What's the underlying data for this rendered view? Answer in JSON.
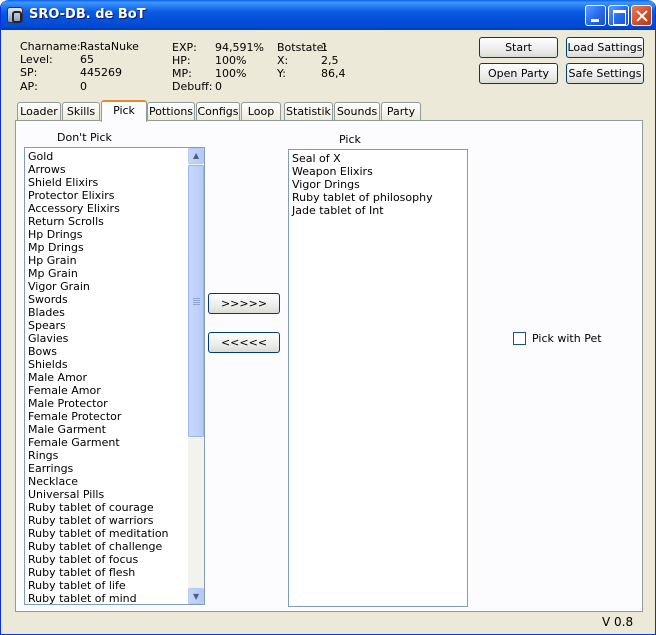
{
  "window": {
    "title": "SRO-DB. de BoT"
  },
  "stats": {
    "charname_label": "Charname:",
    "charname": "RastaNuke",
    "level_label": "Level:",
    "level": "65",
    "sp_label": "SP:",
    "sp": "445269",
    "ap_label": "AP:",
    "ap": "0",
    "exp_label": "EXP:",
    "exp": "94,591%",
    "hp_label": "HP:",
    "hp": "100%",
    "mp_label": "MP:",
    "mp": "100%",
    "debuff_label": "Debuff:",
    "debuff": "0",
    "botstate_label": "Botstate:",
    "botstate": "1",
    "x_label": "X:",
    "x": "2,5",
    "y_label": "Y:",
    "y": "86,4"
  },
  "buttons": {
    "start": "Start",
    "load_settings": "Load Sattings",
    "open_party": "Open Party",
    "safe_settings": "Safe Settings",
    "move_right": ">>>>>",
    "move_left": "<<<<<"
  },
  "tabs": [
    "Loader",
    "Skills",
    "Pick",
    "Pottions",
    "Configs",
    "Loop",
    "Statistik",
    "Sounds",
    "Party"
  ],
  "active_tab": "Pick",
  "pick_panel": {
    "dont_pick_label": "Don't Pick",
    "pick_label": "Pick",
    "pick_with_pet_label": "Pick with Pet",
    "dont_pick_items": [
      "Gold",
      "Arrows",
      "Shield Elixirs",
      "Protector Elixirs",
      "Accessory Elixirs",
      "Return Scrolls",
      "Hp Drings",
      "Mp Drings",
      "Hp Grain",
      "Mp Grain",
      "Vigor Grain",
      "Swords",
      "Blades",
      "Spears",
      "Glavies",
      "Bows",
      "Shields",
      "Male Amor",
      "Female Amor",
      "Male Protector",
      "Female Protector",
      "Male Garment",
      "Female Garment",
      "Rings",
      "Earrings",
      "Necklace",
      "Universal Pills",
      "Ruby tablet of courage",
      "Ruby tablet of warriors",
      "Ruby tablet of meditation",
      "Ruby tablet of challenge",
      "Ruby tablet of focus",
      "Ruby tablet of flesh",
      "Ruby tablet of life",
      "Ruby tablet of mind"
    ],
    "pick_items": [
      "Seal of X",
      "Weapon Elixirs",
      "Vigor Drings",
      "Ruby tablet of philosophy",
      "Jade tablet of Int"
    ]
  },
  "footer": {
    "version": "V 0.8"
  }
}
